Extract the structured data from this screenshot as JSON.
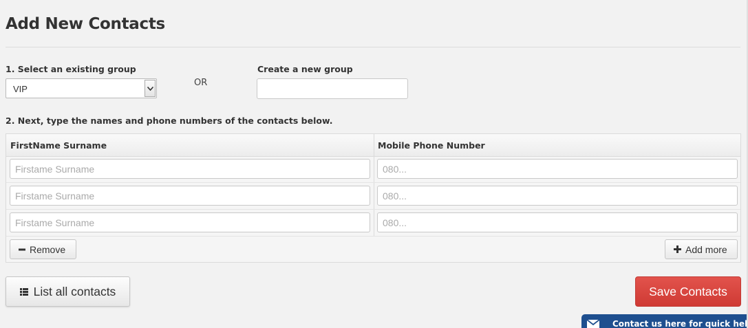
{
  "page": {
    "title": "Add New Contacts"
  },
  "group": {
    "existing_label": "1. Select an existing group",
    "selected": "VIP",
    "or_text": "OR",
    "new_label": "Create a new group",
    "new_value": ""
  },
  "instructions": "2. Next, type the names and phone numbers of the contacts below.",
  "table": {
    "col_name": "FirstName Surname",
    "col_phone": "Mobile Phone Number",
    "rows": [
      {
        "name_placeholder": "Firstame Surname",
        "phone_placeholder": "080..."
      },
      {
        "name_placeholder": "Firstame Surname",
        "phone_placeholder": "080..."
      },
      {
        "name_placeholder": "Firstame Surname",
        "phone_placeholder": "080..."
      }
    ],
    "remove_label": "Remove",
    "add_label": "Add more"
  },
  "actions": {
    "list_label": "List all contacts",
    "save_label": "Save Contacts"
  },
  "help": {
    "label": "Contact us here for quick help"
  },
  "icons": {
    "select_arrow": "chevron-down-icon",
    "remove": "minus-icon",
    "add": "plus-icon",
    "list": "list-icon",
    "mail": "envelope-icon"
  },
  "colors": {
    "save_button": "#d9443e",
    "help_tab": "#1e4f8f"
  }
}
